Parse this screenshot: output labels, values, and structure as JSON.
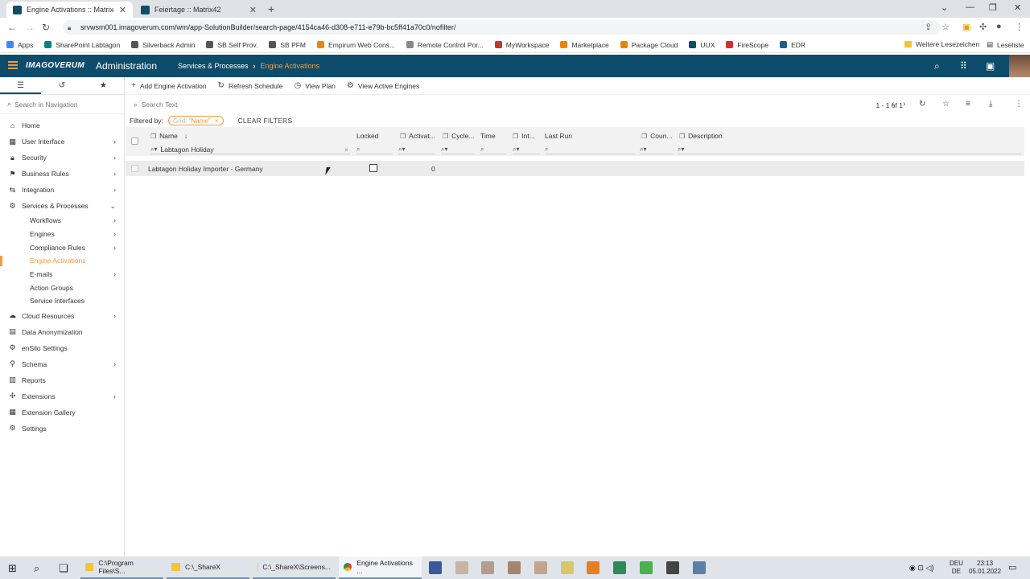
{
  "browser": {
    "tabs": [
      {
        "label": "Engine Activations :: Matrix42",
        "active": true
      },
      {
        "label": "Feiertage :: Matrix42",
        "active": false
      }
    ],
    "new_tab": "+",
    "url": "srvwsm001.imagoverum.com/wm/app-SolutionBuilder/search-page/4154ca46-d308-e711-e79b-bc5ff41a70c0/nofilter/",
    "bookmarks": [
      {
        "label": "Apps",
        "color": "#4285f4"
      },
      {
        "label": "SharePoint Labtagon",
        "color": "#038387"
      },
      {
        "label": "Silverback Admin",
        "color": "#555555"
      },
      {
        "label": "SB Self Prov.",
        "color": "#555555"
      },
      {
        "label": "SB PFM",
        "color": "#555555"
      },
      {
        "label": "Empirum Web Cons...",
        "color": "#e8860c"
      },
      {
        "label": "Remote Control Por...",
        "color": "#888888"
      },
      {
        "label": "MyWorkspace",
        "color": "#c0392b"
      },
      {
        "label": "Marketplace",
        "color": "#e8860c"
      },
      {
        "label": "Package Cloud",
        "color": "#e8860c"
      },
      {
        "label": "UUX",
        "color": "#0e4c6c"
      },
      {
        "label": "FireScope",
        "color": "#d32f2f"
      },
      {
        "label": "EDR",
        "color": "#1a5f8a"
      }
    ],
    "other_bookmarks": "Weitere Lesezeichen",
    "reading_list": "Leseliste"
  },
  "app": {
    "logo": "IMAGOVERUM",
    "title": "Administration",
    "breadcrumb": {
      "parent": "Services & Processes",
      "current": "Engine Activations"
    },
    "accent": "#f59a3d",
    "header_color": "#0e4c6c"
  },
  "sidebar": {
    "search_placeholder": "Search in Navigation",
    "items": [
      {
        "label": "Home",
        "icon": "home-icon",
        "chevron": false
      },
      {
        "label": "User Interface",
        "icon": "grid-icon",
        "chevron": true
      },
      {
        "label": "Security",
        "icon": "lock-icon",
        "chevron": true
      },
      {
        "label": "Business Rules",
        "icon": "flag-icon",
        "chevron": true
      },
      {
        "label": "Integration",
        "icon": "integration-icon",
        "chevron": true
      },
      {
        "label": "Services & Processes",
        "icon": "services-icon",
        "chevron": "down"
      }
    ],
    "subitems": [
      {
        "label": "Workflows",
        "chevron": true,
        "active": false
      },
      {
        "label": "Engines",
        "chevron": true,
        "active": false
      },
      {
        "label": "Compliance Rules",
        "chevron": true,
        "active": false
      },
      {
        "label": "Engine Activations",
        "chevron": false,
        "active": true
      },
      {
        "label": "E-mails",
        "chevron": true,
        "active": false
      },
      {
        "label": "Action Groups",
        "chevron": false,
        "active": false
      },
      {
        "label": "Service Interfaces",
        "chevron": false,
        "active": false
      }
    ],
    "items_after": [
      {
        "label": "Cloud Resources",
        "icon": "cloud-icon",
        "chevron": true
      },
      {
        "label": "Data Anonymization",
        "icon": "database-icon",
        "chevron": false
      },
      {
        "label": "enSilo Settings",
        "icon": "gear-icon",
        "chevron": false
      },
      {
        "label": "Schema",
        "icon": "schema-icon",
        "chevron": true
      },
      {
        "label": "Reports",
        "icon": "reports-icon",
        "chevron": false
      },
      {
        "label": "Extensions",
        "icon": "puzzle-icon",
        "chevron": true
      },
      {
        "label": "Extension Gallery",
        "icon": "gallery-icon",
        "chevron": false
      },
      {
        "label": "Settings",
        "icon": "settings-icon",
        "chevron": false
      }
    ]
  },
  "toolbar": {
    "add": "Add Engine Activation",
    "refresh": "Refresh Schedule",
    "view_plan": "View Plan",
    "view_active": "View Active Engines"
  },
  "grid": {
    "search_placeholder": "Search Text",
    "pager": "1 - 1 of 1",
    "filtered_by": "Filtered by:",
    "chip_label": "Grid:",
    "chip_value": "\"Name\"",
    "clear_filters": "CLEAR FILTERS",
    "columns": [
      "Name",
      "Locked",
      "Activat...",
      "Cycle...",
      "Time",
      "Int...",
      "Last Run",
      "Coun...",
      "Description"
    ],
    "name_filter": "Labtagon Holiday",
    "rows": [
      {
        "name": "Labtagon Holiday Importer - Germany",
        "locked": false,
        "activations": "0"
      }
    ]
  },
  "taskbar": {
    "apps": [
      {
        "label": "C:\\Program Files\\S...",
        "active": false
      },
      {
        "label": "C:\\_ShareX",
        "active": false
      },
      {
        "label": "C:\\_ShareX\\Screens...",
        "active": false
      },
      {
        "label": "Engine Activations ...",
        "active": true
      }
    ],
    "lang": "DEU",
    "region": "DE",
    "time": "23:13",
    "date": "05.01.2022"
  }
}
